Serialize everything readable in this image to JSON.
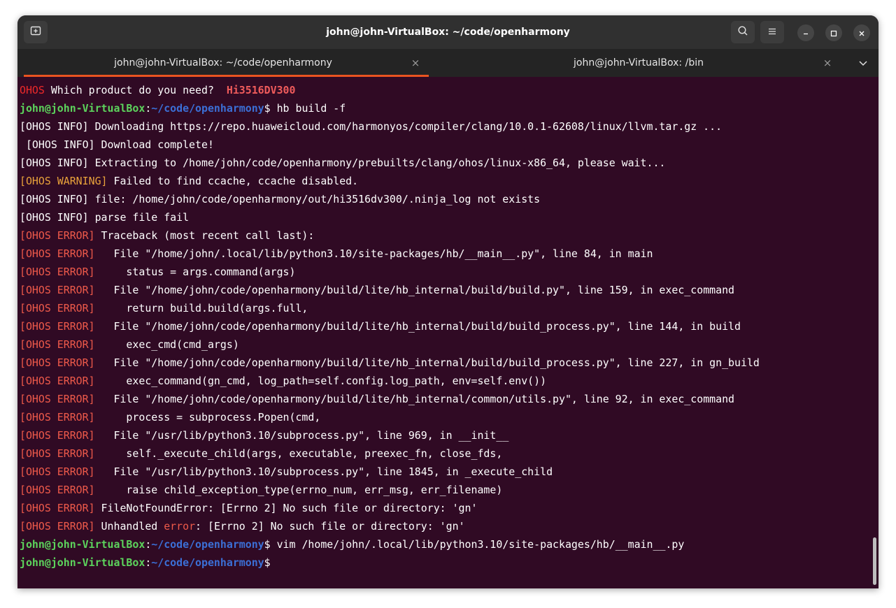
{
  "window": {
    "title": "john@john-VirtualBox: ~/code/openharmony",
    "colors": {
      "terminal_bg": "#300a24",
      "titlebar_bg": "#303030",
      "tab_accent": "#e95420"
    }
  },
  "titlebar_icons": {
    "new_tab": "new-tab-icon",
    "search": "search-icon",
    "menu": "hamburger-menu-icon",
    "minimize": "minimize-icon",
    "maximize": "maximize-icon",
    "close": "close-icon"
  },
  "tabs": [
    {
      "label": "john@john-VirtualBox: ~/code/openharmony",
      "close": "×",
      "active": true
    },
    {
      "label": "john@john-VirtualBox: /bin",
      "close": "×",
      "active": false
    }
  ],
  "terminal": {
    "lines": [
      [
        {
          "t": "OHOS",
          "c": "c-ohos"
        },
        {
          "t": " Which product do you need?  "
        },
        {
          "t": "Hi3516DV300",
          "c": "c-prod"
        }
      ],
      [
        {
          "t": "john@john-VirtualBox",
          "c": "c-user"
        },
        {
          "t": ":"
        },
        {
          "t": "~/code/openharmony",
          "c": "c-path"
        },
        {
          "t": "$ hb build -f"
        }
      ],
      [
        {
          "t": "[OHOS INFO] Downloading https://repo.huaweicloud.com/harmonyos/compiler/clang/10.0.1-62608/linux/llvm.tar.gz ..."
        }
      ],
      [
        {
          "t": " [OHOS INFO] Download complete!"
        }
      ],
      [
        {
          "t": "[OHOS INFO] Extracting to /home/john/code/openharmony/prebuilts/clang/ohos/linux-x86_64, please wait..."
        }
      ],
      [
        {
          "t": "[OHOS WARNING]",
          "c": "c-warn"
        },
        {
          "t": " Failed to find ccache, ccache disabled."
        }
      ],
      [
        {
          "t": "[OHOS INFO] file: /home/john/code/openharmony/out/hi3516dv300/.ninja_log not exists"
        }
      ],
      [
        {
          "t": "[OHOS INFO] parse file fail"
        }
      ],
      [
        {
          "t": "[OHOS ERROR]",
          "c": "c-err"
        },
        {
          "t": " Traceback (most recent call last):"
        }
      ],
      [
        {
          "t": "[OHOS ERROR]",
          "c": "c-err"
        },
        {
          "t": "   File \"/home/john/.local/lib/python3.10/site-packages/hb/__main__.py\", line 84, in main"
        }
      ],
      [
        {
          "t": "[OHOS ERROR]",
          "c": "c-err"
        },
        {
          "t": "     status = args.command(args)"
        }
      ],
      [
        {
          "t": "[OHOS ERROR]",
          "c": "c-err"
        },
        {
          "t": "   File \"/home/john/code/openharmony/build/lite/hb_internal/build/build.py\", line 159, in exec_command"
        }
      ],
      [
        {
          "t": "[OHOS ERROR]",
          "c": "c-err"
        },
        {
          "t": "     return build.build(args.full,"
        }
      ],
      [
        {
          "t": "[OHOS ERROR]",
          "c": "c-err"
        },
        {
          "t": "   File \"/home/john/code/openharmony/build/lite/hb_internal/build/build_process.py\", line 144, in build"
        }
      ],
      [
        {
          "t": "[OHOS ERROR]",
          "c": "c-err"
        },
        {
          "t": "     exec_cmd(cmd_args)"
        }
      ],
      [
        {
          "t": "[OHOS ERROR]",
          "c": "c-err"
        },
        {
          "t": "   File \"/home/john/code/openharmony/build/lite/hb_internal/build/build_process.py\", line 227, in gn_build"
        }
      ],
      [
        {
          "t": "[OHOS ERROR]",
          "c": "c-err"
        },
        {
          "t": "     exec_command(gn_cmd, log_path=self.config.log_path, env=self.env())"
        }
      ],
      [
        {
          "t": "[OHOS ERROR]",
          "c": "c-err"
        },
        {
          "t": "   File \"/home/john/code/openharmony/build/lite/hb_internal/common/utils.py\", line 92, in exec_command"
        }
      ],
      [
        {
          "t": "[OHOS ERROR]",
          "c": "c-err"
        },
        {
          "t": "     process = subprocess.Popen(cmd,"
        }
      ],
      [
        {
          "t": "[OHOS ERROR]",
          "c": "c-err"
        },
        {
          "t": "   File \"/usr/lib/python3.10/subprocess.py\", line 969, in __init__"
        }
      ],
      [
        {
          "t": "[OHOS ERROR]",
          "c": "c-err"
        },
        {
          "t": "     self._execute_child(args, executable, preexec_fn, close_fds,"
        }
      ],
      [
        {
          "t": "[OHOS ERROR]",
          "c": "c-err"
        },
        {
          "t": "   File \"/usr/lib/python3.10/subprocess.py\", line 1845, in _execute_child"
        }
      ],
      [
        {
          "t": "[OHOS ERROR]",
          "c": "c-err"
        },
        {
          "t": "     raise child_exception_type(errno_num, err_msg, err_filename)"
        }
      ],
      [
        {
          "t": "[OHOS ERROR]",
          "c": "c-err"
        },
        {
          "t": " FileNotFoundError: [Errno 2] No such file or directory: 'gn'"
        }
      ],
      [
        {
          "t": "[OHOS ERROR]",
          "c": "c-err"
        },
        {
          "t": " Unhandled "
        },
        {
          "t": "error",
          "c": "c-err"
        },
        {
          "t": ": [Errno 2] No such file or directory: 'gn'"
        }
      ],
      [
        {
          "t": "john@john-VirtualBox",
          "c": "c-user"
        },
        {
          "t": ":"
        },
        {
          "t": "~/code/openharmony",
          "c": "c-path"
        },
        {
          "t": "$ vim /home/john/.local/lib/python3.10/site-packages/hb/__main__.py"
        }
      ],
      [
        {
          "t": "john@john-VirtualBox",
          "c": "c-user"
        },
        {
          "t": ":"
        },
        {
          "t": "~/code/openharmony",
          "c": "c-path"
        },
        {
          "t": "$ "
        }
      ]
    ]
  }
}
